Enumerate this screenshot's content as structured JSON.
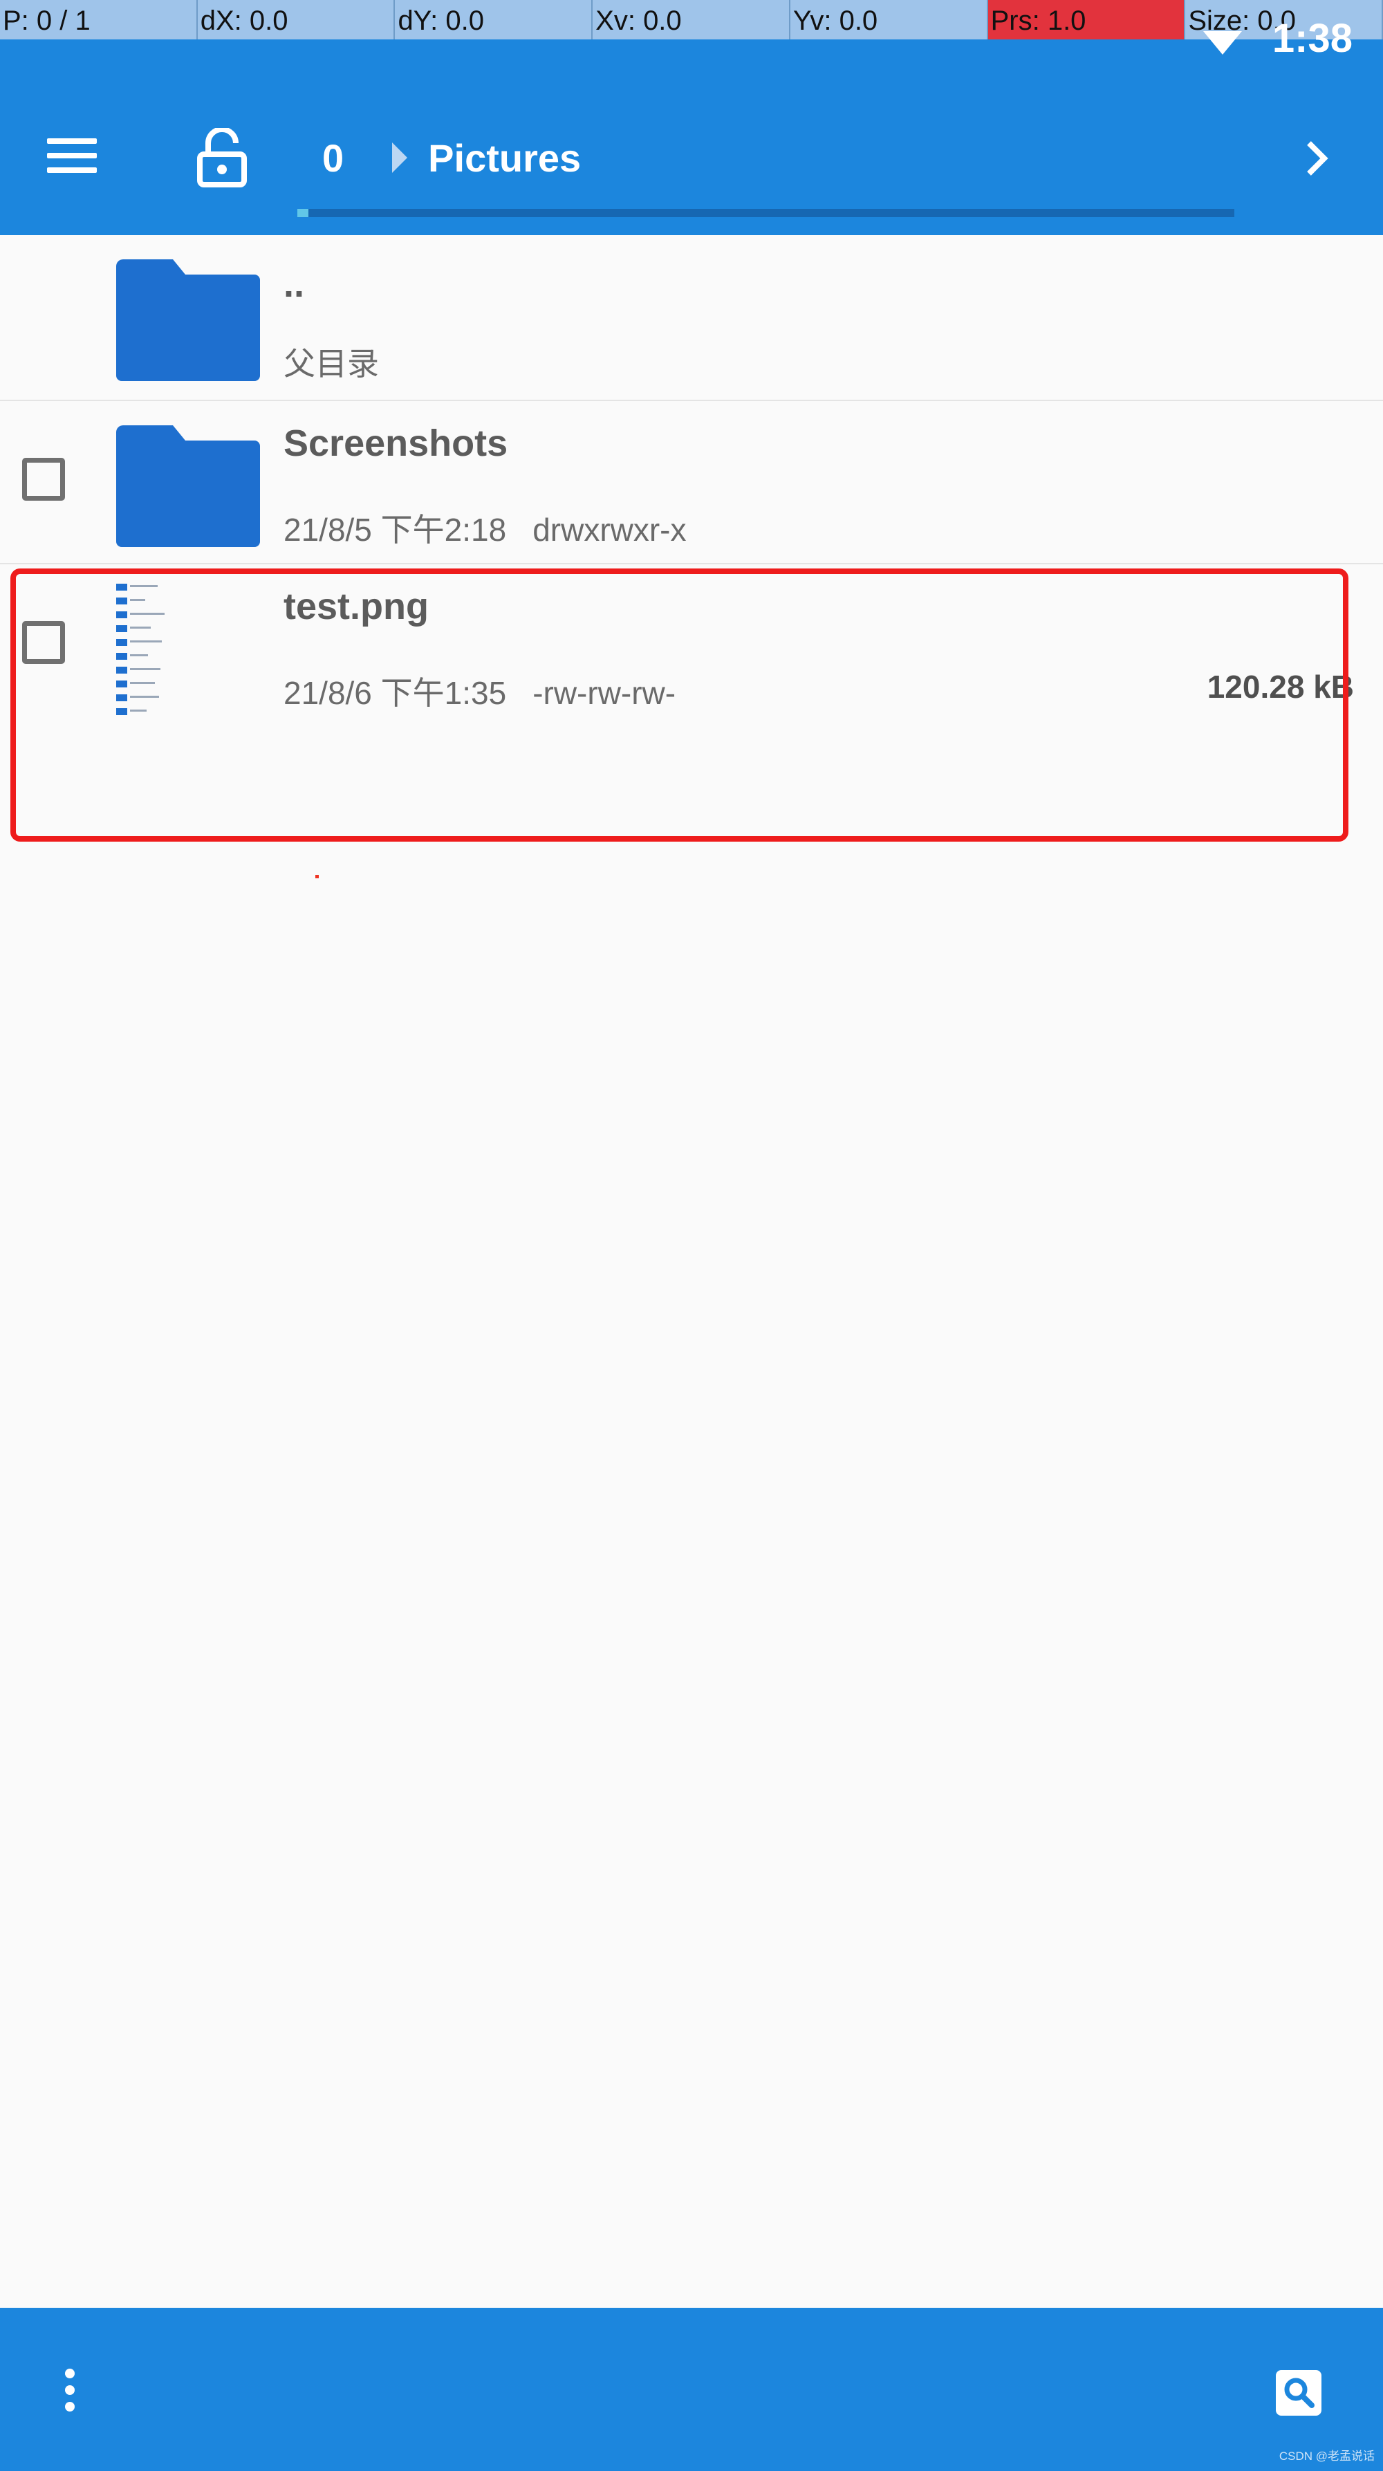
{
  "debug_bar": {
    "pointer": "P: 0 / 1",
    "dx": "dX: 0.0",
    "dy": "dY: 0.0",
    "xv": "Xv: 0.0",
    "yv": "Yv: 0.0",
    "prs": "Prs: 1.0",
    "size": "Size: 0.0"
  },
  "status_bar": {
    "time": "1:38",
    "wifi_icon": "wifi-icon"
  },
  "toolbar": {
    "menu_icon": "menu-icon",
    "lock_icon": "unlocked-padlock-icon",
    "breadcrumb_root": "0",
    "breadcrumb_current": "Pictures",
    "next_icon": "chevron-right-icon",
    "accent": "#1c86dd"
  },
  "files": [
    {
      "name": "..",
      "subtitle": "父目录",
      "icon": "folder-icon"
    },
    {
      "name": "Screenshots",
      "date": "21/8/5 下午2:18",
      "permissions": "drwxrwxr-x",
      "icon": "folder-icon"
    },
    {
      "name": "test.png",
      "date": "21/8/6 下午1:35",
      "permissions": "-rw-rw-rw-",
      "size": "120.28 kB",
      "icon": "image-thumbnail"
    }
  ],
  "bottom_bar": {
    "more_icon": "more-vert-icon",
    "search_icon": "search-icon",
    "watermark": "CSDN @老孟说话"
  },
  "colors": {
    "folder": "#1e6fcf",
    "highlight": "#ee1c1c",
    "prs_cell": "#e2333d"
  }
}
